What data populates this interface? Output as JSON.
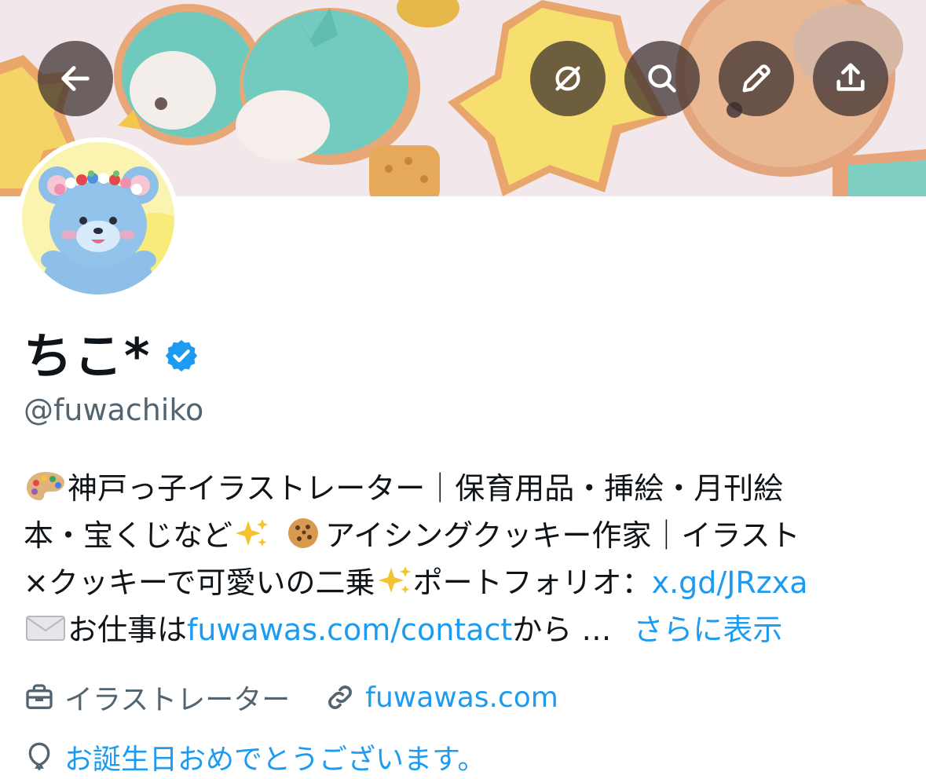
{
  "header": {
    "buttons": {
      "back": "back-arrow-icon",
      "grok": "grok-icon",
      "search": "search-icon",
      "edit": "pencil-icon",
      "share": "share-icon"
    }
  },
  "profile": {
    "display_name": "ちこ*",
    "handle": "@fuwachiko",
    "verified_color": "#1d9bf0",
    "bio": {
      "line1_text": "神戸っ子イラストレーター｜保育用品・挿絵・月刊絵",
      "line2_a": "本・宝くじなど",
      "line2_b": "アイシングクッキー作家｜イラスト",
      "line3_text": "×クッキーで可愛いの二乗",
      "line3_b": "ポートフォリオ：",
      "line3_link": "x.gd/JRzxa",
      "line4_a": "お仕事は",
      "line4_link": "fuwawas.com/contact",
      "line4_b": "から …",
      "show_more": "さらに表示"
    },
    "meta": {
      "profession": "イラストレーター",
      "website": "fuwawas.com",
      "birthday": "お誕生日おめでとうございます。"
    }
  },
  "colors": {
    "link": "#1d9bf0",
    "secondary": "#536471",
    "text": "#0f1419"
  }
}
